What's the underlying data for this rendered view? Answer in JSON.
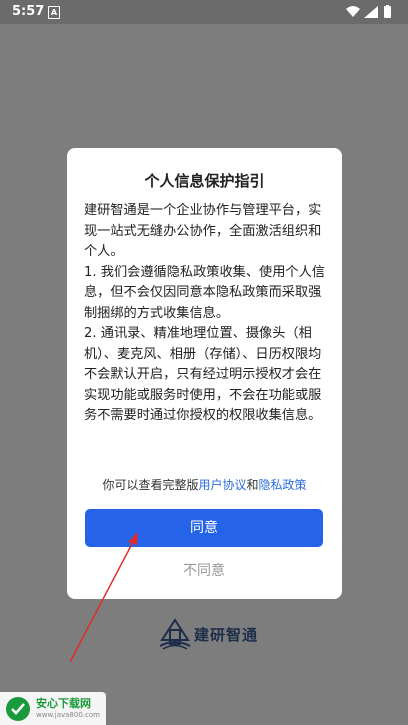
{
  "status_bar": {
    "time": "5:57",
    "notification": "A",
    "icons": [
      "wifi-icon",
      "signal-icon",
      "battery-icon"
    ]
  },
  "dialog": {
    "title": "个人信息保护指引",
    "paragraphs": [
      "建研智通是一个企业协作与管理平台，实现一站式无缝办公协作，全面激活组织和个人。",
      "1. 我们会遵循隐私政策收集、使用个人信息，但不会仅因同意本隐私政策而采取强制捆绑的方式收集信息。",
      "2. 通讯录、精准地理位置、摄像头（相机）、麦克风、相册（存储）、日历权限均不会默认开启，只有经过明示授权才会在实现功能或服务时使用，不会在功能或服务不需要时通过你授权的权限收集信息。"
    ],
    "agreement_prefix": "你可以查看完整版",
    "user_agreement_link": "用户协议",
    "and_text": "和",
    "privacy_policy_link": "隐私政策",
    "agree_button": "同意",
    "disagree_button": "不同意"
  },
  "brand": {
    "name": "建研智通"
  },
  "watermark": {
    "title": "安心下载网",
    "url": "www.java800.com"
  },
  "colors": {
    "accent": "#2563e8",
    "link": "#2b6de0",
    "overlay": "#7d7d7d"
  }
}
